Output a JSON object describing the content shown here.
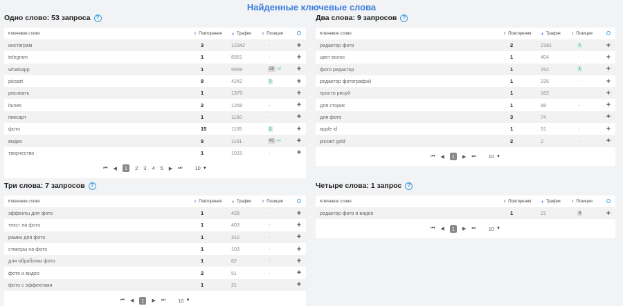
{
  "title": "Найденные ключевые слова",
  "columns": {
    "keyword": "Ключевое слово",
    "repeats": "Повторения",
    "traffic": "Трафик",
    "position": "Позиция"
  },
  "sections": [
    {
      "title": "Одно слово: 53 запроса",
      "rows": [
        {
          "kw": "инстаграм",
          "rep": "3",
          "tr": "12342",
          "pos": "-"
        },
        {
          "kw": "telegram",
          "rep": "1",
          "tr": "8351",
          "pos": "-"
        },
        {
          "kw": "whatsapp",
          "rep": "1",
          "tr": "5939",
          "pos": "28",
          "delta": "+2",
          "badge": "gray"
        },
        {
          "kw": "picsart",
          "rep": "8",
          "tr": "4242",
          "pos": "1",
          "badge": "teal"
        },
        {
          "kw": "рисовать",
          "rep": "1",
          "tr": "1379",
          "pos": "-"
        },
        {
          "kw": "itunes",
          "rep": "2",
          "tr": "1258",
          "pos": "-"
        },
        {
          "kw": "пиксарт",
          "rep": "1",
          "tr": "1160",
          "pos": "-"
        },
        {
          "kw": "фото",
          "rep": "15",
          "tr": "1105",
          "pos": "1",
          "badge": "teal"
        },
        {
          "kw": "видео",
          "rep": "9",
          "tr": "1101",
          "pos": "41",
          "delta": "+1",
          "badge": "gray"
        },
        {
          "kw": "творчество",
          "rep": "1",
          "tr": "1015",
          "pos": "-"
        }
      ],
      "pages": [
        "1",
        "2",
        "3",
        "4",
        "5"
      ],
      "per_page": "10"
    },
    {
      "title": "Два слова: 9 запросов",
      "rows": [
        {
          "kw": "редактор фото",
          "rep": "2",
          "tr": "2181",
          "pos": "1",
          "badge": "teal"
        },
        {
          "kw": "цвет волос",
          "rep": "1",
          "tr": "404",
          "pos": "-"
        },
        {
          "kw": "фото редактор",
          "rep": "1",
          "tr": "252",
          "pos": "1",
          "badge": "teal"
        },
        {
          "kw": "редактор фотографий",
          "rep": "1",
          "tr": "235",
          "pos": "-"
        },
        {
          "kw": "просто рисуй",
          "rep": "1",
          "tr": "162",
          "pos": "-"
        },
        {
          "kw": "для сторис",
          "rep": "1",
          "tr": "88",
          "pos": "-"
        },
        {
          "kw": "для фото",
          "rep": "3",
          "tr": "74",
          "pos": "-"
        },
        {
          "kw": "apple id",
          "rep": "1",
          "tr": "51",
          "pos": "-"
        },
        {
          "kw": "picsart gold",
          "rep": "2",
          "tr": "2",
          "pos": "-"
        }
      ],
      "pages": [
        "1"
      ],
      "per_page": "10"
    },
    {
      "title": "Три слова: 7 запросов",
      "rows": [
        {
          "kw": "эффекты для фото",
          "rep": "1",
          "tr": "428",
          "pos": "-"
        },
        {
          "kw": "текст на фото",
          "rep": "1",
          "tr": "403",
          "pos": "-"
        },
        {
          "kw": "рамки для фото",
          "rep": "1",
          "tr": "312",
          "pos": "-"
        },
        {
          "kw": "стикеры на фото",
          "rep": "1",
          "tr": "103",
          "pos": "-"
        },
        {
          "kw": "для обработки фото",
          "rep": "1",
          "tr": "62",
          "pos": "-"
        },
        {
          "kw": "фото и видео",
          "rep": "2",
          "tr": "51",
          "pos": "-"
        },
        {
          "kw": "фото с эффектами",
          "rep": "1",
          "tr": "21",
          "pos": "-"
        }
      ],
      "pages": [
        "1"
      ],
      "per_page": "10"
    },
    {
      "title": "Четыре слова: 1 запрос",
      "rows": [
        {
          "kw": "редактор фото и видео",
          "rep": "1",
          "tr": "21",
          "pos": "8",
          "badge": "gray"
        }
      ],
      "pages": [
        "1"
      ],
      "per_page": "10"
    }
  ]
}
